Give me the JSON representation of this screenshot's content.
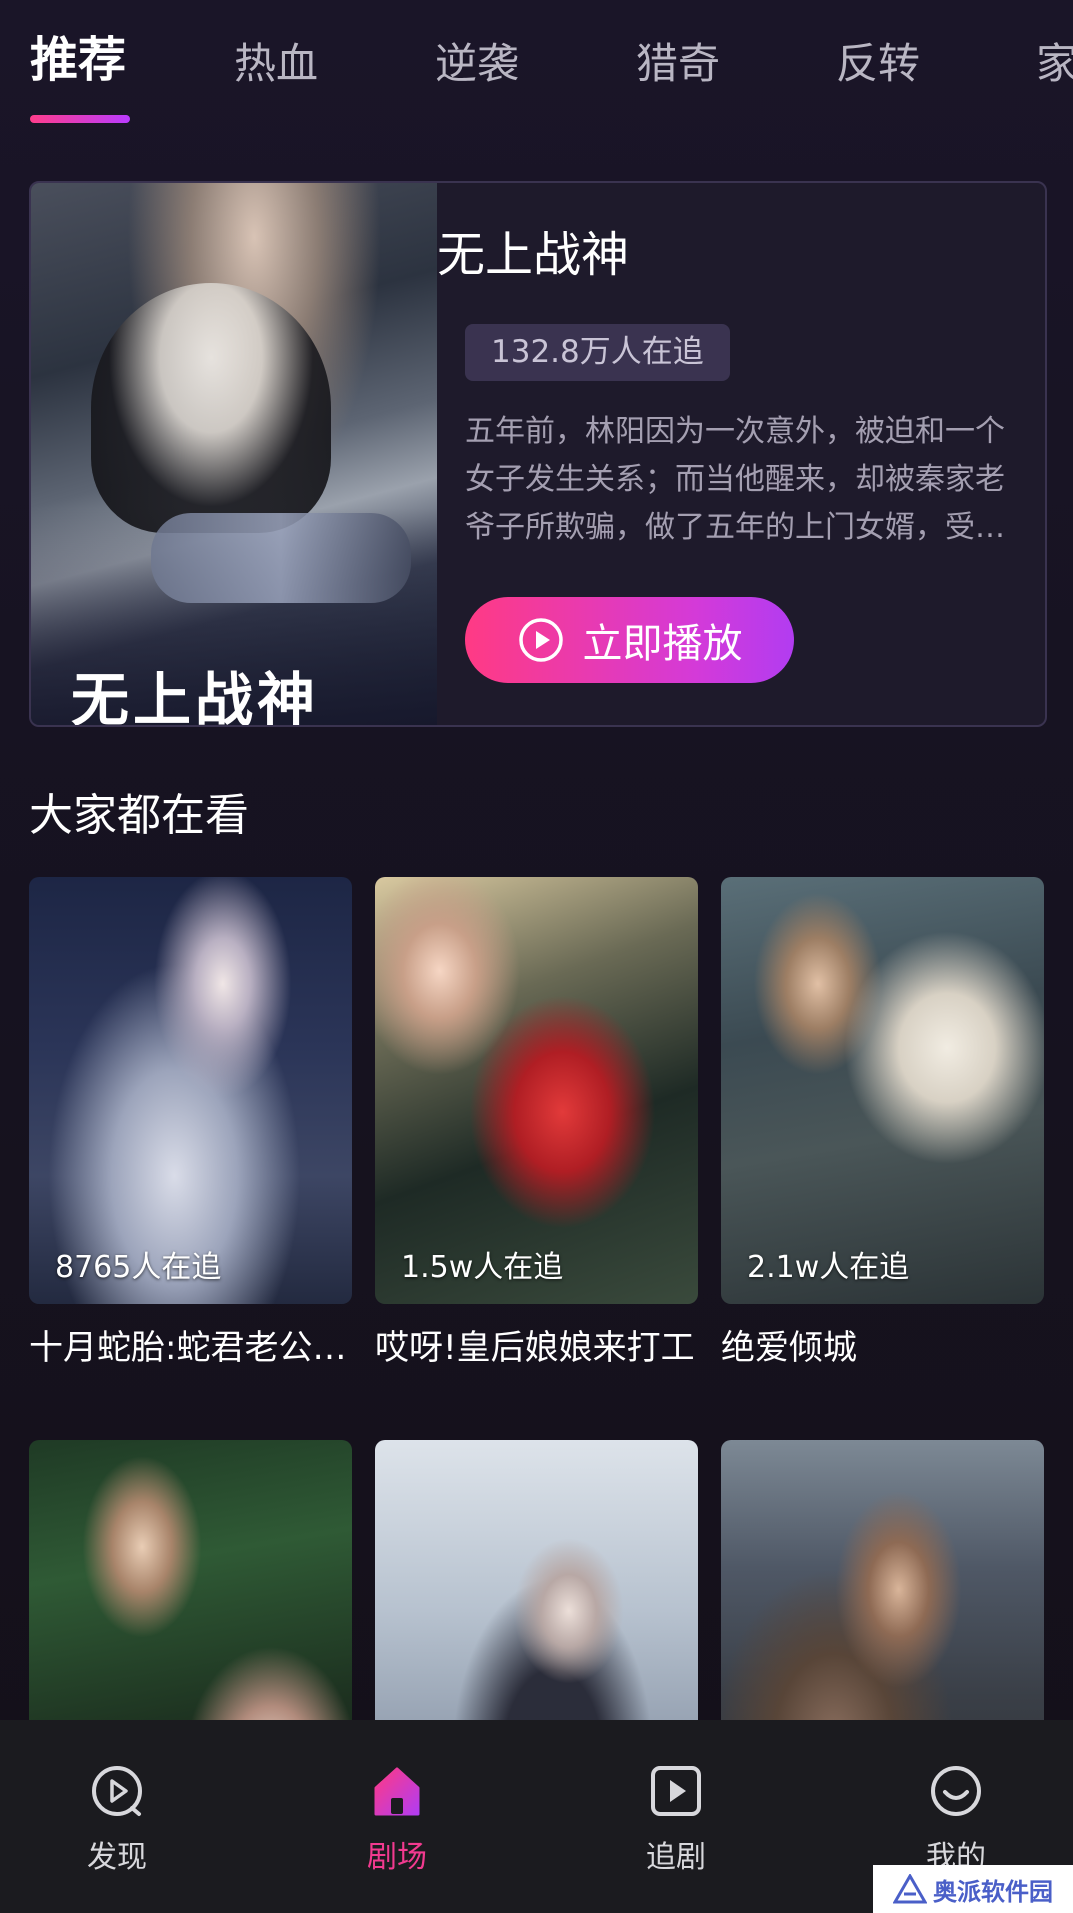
{
  "tabs": [
    {
      "label": "推荐",
      "active": true
    },
    {
      "label": "热血",
      "active": false
    },
    {
      "label": "逆袭",
      "active": false
    },
    {
      "label": "猎奇",
      "active": false
    },
    {
      "label": "反转",
      "active": false
    },
    {
      "label": "家",
      "active": false
    }
  ],
  "featured": {
    "title": "无上战神",
    "followers": "132.8万人在追",
    "description": "五年前，林阳因为一次意外，被迫和一个女子发生关系；而当他醒来，却被秦家老爷子所欺骗，做了五年的上门女婿，受尽屈辱……",
    "play_label": "立即播放",
    "poster_art_text": "无上战神"
  },
  "section": {
    "title": "大家都在看",
    "items": [
      {
        "title": "十月蛇胎:蛇君老公请轻点",
        "count": "8765人在追"
      },
      {
        "title": "哎呀!皇后娘娘来打工",
        "count": "1.5w人在追"
      },
      {
        "title": "绝爱倾城",
        "count": "2.1w人在追"
      },
      {
        "title": "",
        "count": ""
      },
      {
        "title": "",
        "count": ""
      },
      {
        "title": "",
        "count": ""
      }
    ]
  },
  "bottom_nav": [
    {
      "label": "发现",
      "icon": "discover-icon",
      "active": false
    },
    {
      "label": "剧场",
      "icon": "home-icon",
      "active": true
    },
    {
      "label": "追剧",
      "icon": "play-square-icon",
      "active": false
    },
    {
      "label": "我的",
      "icon": "smile-face-icon",
      "active": false
    }
  ],
  "watermark": {
    "text": "奥派软件园"
  },
  "colors": {
    "accent_pink": "#ff3a84",
    "accent_purple": "#b23cf1",
    "background": "#171322",
    "nav_active": "#f23a8f"
  }
}
